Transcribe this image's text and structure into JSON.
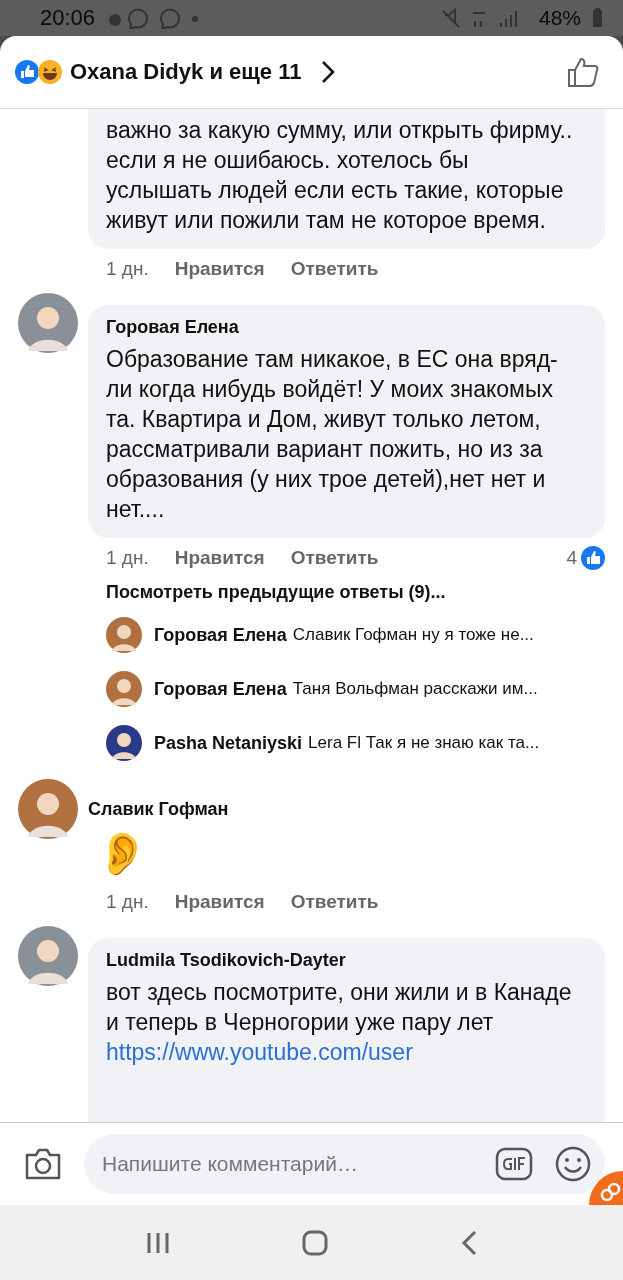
{
  "status_bar": {
    "time": "20:06",
    "battery": "48%"
  },
  "header": {
    "title": "Oxana Didyk и еще 11"
  },
  "comments": [
    {
      "kind": "bubble",
      "continued": true,
      "text": "важно за какую сумму, или открыть фирму.. если я не ошибаюсь. хотелось бы услышать людей если есть такие, которые живут или пожили там не которое время.",
      "time": "1 дн.",
      "like": "Нравится",
      "reply": "Ответить"
    },
    {
      "kind": "bubble",
      "continued": false,
      "name": "Горовая Елена",
      "text": "Образование там никакое, в ЕС она вряд-ли когда нибудь войдёт! У моих знакомых та. Квартира и Дом, живут только летом, рассматривали вариант пожить, но из за образования (у них трое детей),нет нет и нет....",
      "time": "1 дн.",
      "like": "Нравится",
      "reply": "Ответить",
      "reactions": "4"
    },
    {
      "kind": "replies",
      "more": "Посмотреть предыдущие ответы (9)...",
      "items": [
        {
          "name": "Горовая Елена",
          "text": "Славик Гофман ну я тоже не..."
        },
        {
          "name": "Горовая Елена",
          "text": "Таня Вольфман расскажи им..."
        },
        {
          "name": "Pasha Netaniyski",
          "text": "Lera Fl Так я не знаю как та..."
        }
      ]
    },
    {
      "kind": "emoji",
      "continued": false,
      "name": "Славик Гофман",
      "text": "👂",
      "time": "1 дн.",
      "like": "Нравится",
      "reply": "Ответить"
    },
    {
      "kind": "bubble",
      "continued": false,
      "name": "Ludmila Tsodikovich-Dayter",
      "text": "вот здесь посмотрите, они жили и в Канаде и теперь в Черногории уже пару лет",
      "link": "https://www.youtube.com/user"
    }
  ],
  "composer": {
    "placeholder": "Напишите комментарий…"
  }
}
